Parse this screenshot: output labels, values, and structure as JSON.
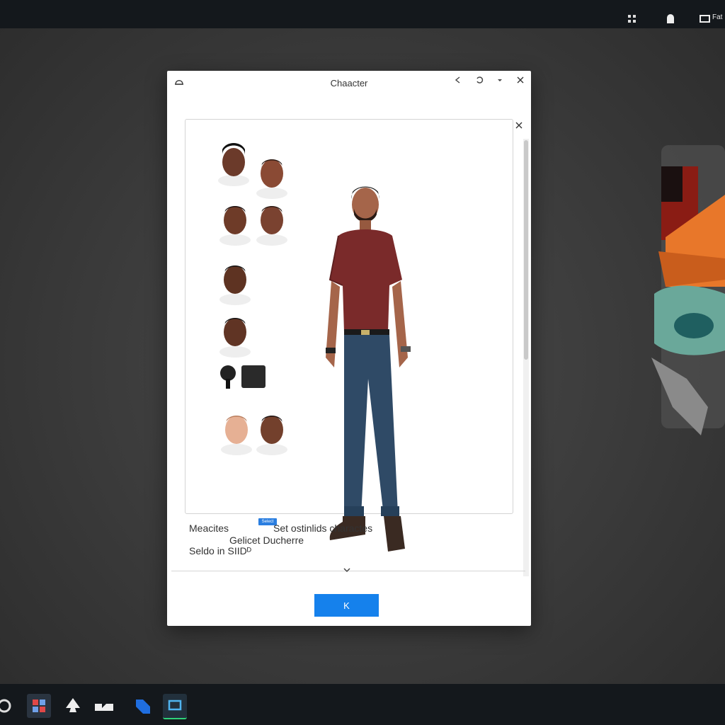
{
  "tray": {
    "label": "Fat"
  },
  "dialog": {
    "title": "Chaacter",
    "ok_label": "K"
  },
  "gallery": {
    "select_tag": "Select",
    "label": "Gelicet Ducherre"
  },
  "details": {
    "row1_label": "Meacites",
    "row1_value": "Set ostinlids charactes",
    "row2_label": "Seldo in SIIDᴰ"
  },
  "icons": {
    "title": "chat-bubble-icon",
    "back": "arrow-left-icon",
    "refresh": "refresh-icon",
    "minimize": "minimize-icon",
    "close": "close-icon",
    "panel_close": "close-icon",
    "expand": "chevron-down-icon"
  },
  "colors": {
    "accent": "#1581ec",
    "shirt": "#7a2a2a",
    "jeans": "#2f4a66",
    "skin": "#a5654a"
  }
}
